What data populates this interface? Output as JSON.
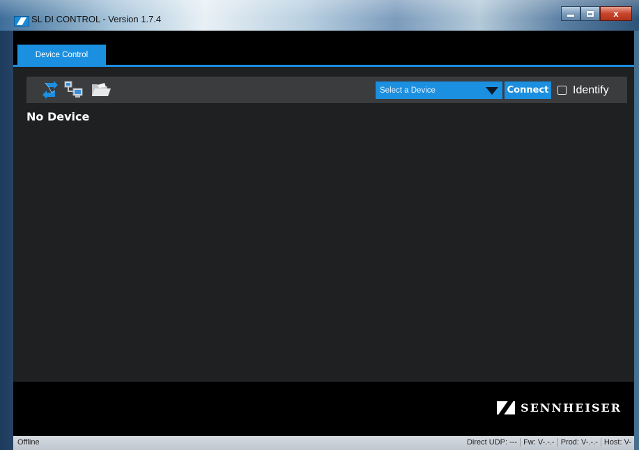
{
  "window": {
    "title": "SL DI CONTROL - Version 1.7.4",
    "controls": {
      "minimize": "minimize",
      "maximize": "maximize",
      "close": "x"
    }
  },
  "tabs": [
    {
      "label": "Device Control",
      "active": true
    }
  ],
  "toolbar": {
    "icons": [
      "sync-icon",
      "network-icon",
      "folder-icon"
    ],
    "device_select": {
      "selected": "Select a Device"
    },
    "connect_label": "Connect",
    "identify_label": "Identify",
    "identify_checked": false
  },
  "main": {
    "message": "No Device"
  },
  "footer": {
    "brand": "SENNHEISER"
  },
  "statusbar": {
    "state": "Offline",
    "direct_udp": "Direct UDP: ---",
    "fw": "Fw: V-.-.-",
    "prod": "Prod: V-.-.-",
    "host": "Host: V-"
  },
  "colors": {
    "accent": "#1b8fe0",
    "background": "#1f2022",
    "toolbar": "#3b3c3e"
  }
}
